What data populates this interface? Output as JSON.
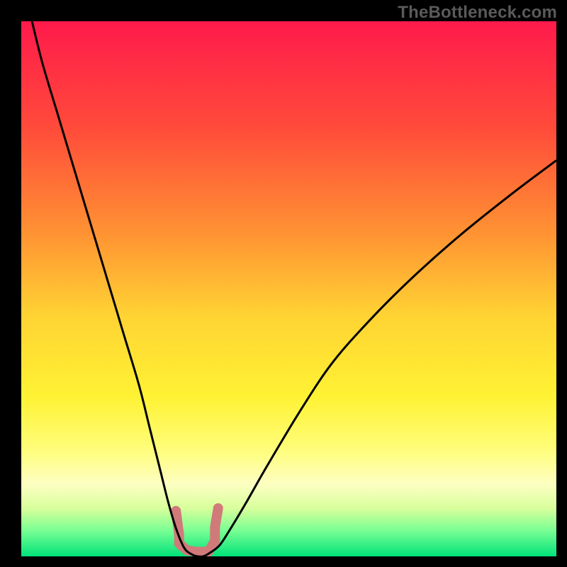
{
  "watermark": "TheBottleneck.com",
  "chart_data": {
    "type": "line",
    "title": "",
    "xlabel": "",
    "ylabel": "",
    "xlim": [
      0,
      100
    ],
    "ylim": [
      0,
      100
    ],
    "background_gradient": {
      "stops": [
        {
          "offset": 0.0,
          "color": "#ff1a4b"
        },
        {
          "offset": 0.2,
          "color": "#ff4b3a"
        },
        {
          "offset": 0.4,
          "color": "#ff9433"
        },
        {
          "offset": 0.55,
          "color": "#ffd333"
        },
        {
          "offset": 0.7,
          "color": "#fff233"
        },
        {
          "offset": 0.8,
          "color": "#fffd7a"
        },
        {
          "offset": 0.865,
          "color": "#fdffc2"
        },
        {
          "offset": 0.91,
          "color": "#d8ff9c"
        },
        {
          "offset": 0.95,
          "color": "#7dff94"
        },
        {
          "offset": 1.0,
          "color": "#00e37a"
        }
      ]
    },
    "series": [
      {
        "name": "bottleneck-curve",
        "color": "#000000",
        "width": 3,
        "x": [
          2,
          4,
          7,
          10,
          13,
          16,
          19,
          22,
          24,
          26,
          27.5,
          29,
          30.5,
          32,
          33,
          34,
          35,
          37,
          39,
          42,
          46,
          52,
          58,
          65,
          73,
          82,
          92,
          100
        ],
        "y": [
          100,
          92,
          82,
          72,
          62,
          52,
          42,
          32,
          24,
          16,
          10,
          5,
          1.5,
          0.3,
          0,
          0,
          0.5,
          2,
          5,
          10,
          17,
          27,
          36,
          44,
          52,
          60,
          68,
          74
        ]
      }
    ],
    "highlight": {
      "name": "optimal-range",
      "color": "#d17a7a",
      "points": [
        {
          "x": 28.9,
          "y_top": 8.5,
          "y_bot": 2.8
        },
        {
          "x": 29.5,
          "y_top": 4.0,
          "y_bot": 0.8
        },
        {
          "x": 31.0,
          "y_top": 2.2,
          "y_bot": 0.0
        },
        {
          "x": 33.0,
          "y_top": 1.7,
          "y_bot": 0.0
        },
        {
          "x": 35.0,
          "y_top": 1.8,
          "y_bot": 0.0
        },
        {
          "x": 36.2,
          "y_top": 5.5,
          "y_bot": 0.3
        },
        {
          "x": 36.8,
          "y_top": 9.0,
          "y_bot": 3.2
        }
      ]
    }
  }
}
